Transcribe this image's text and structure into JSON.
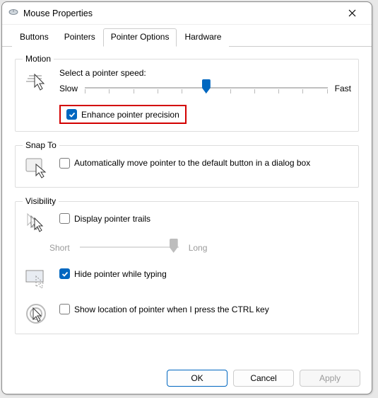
{
  "window": {
    "title": "Mouse Properties"
  },
  "tabs": {
    "buttons": "Buttons",
    "pointers": "Pointers",
    "pointer_options": "Pointer Options",
    "hardware": "Hardware",
    "active": "pointer_options"
  },
  "motion": {
    "legend": "Motion",
    "speed_label": "Select a pointer speed:",
    "slow": "Slow",
    "fast": "Fast",
    "enhance_precision": {
      "checked": true,
      "label": "Enhance pointer precision"
    }
  },
  "snap_to": {
    "legend": "Snap To",
    "auto_default": {
      "checked": false,
      "label": "Automatically move pointer to the default button in a dialog box"
    }
  },
  "visibility": {
    "legend": "Visibility",
    "trails": {
      "checked": false,
      "label": "Display pointer trails",
      "short": "Short",
      "long": "Long"
    },
    "hide_typing": {
      "checked": true,
      "label": "Hide pointer while typing"
    },
    "ctrl_locate": {
      "checked": false,
      "label": "Show location of pointer when I press the CTRL key"
    }
  },
  "footer": {
    "ok": "OK",
    "cancel": "Cancel",
    "apply": "Apply"
  }
}
